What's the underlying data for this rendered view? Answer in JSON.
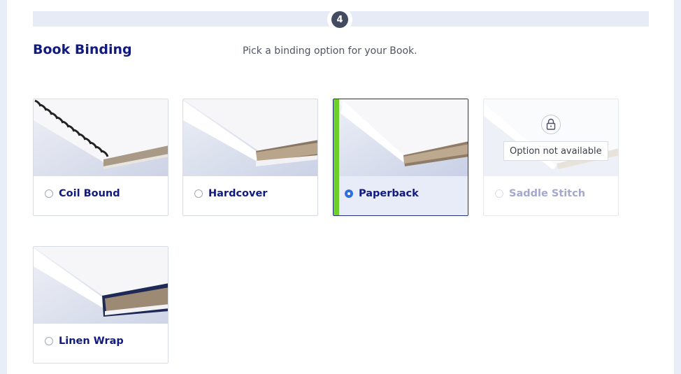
{
  "step": {
    "number": "4"
  },
  "section": {
    "title": "Book Binding",
    "description": "Pick a binding option for your Book."
  },
  "bindings": [
    {
      "label": "Coil Bound",
      "selected": false,
      "available": true
    },
    {
      "label": "Hardcover",
      "selected": false,
      "available": true
    },
    {
      "label": "Paperback",
      "selected": true,
      "available": true
    },
    {
      "label": "Saddle Stitch",
      "selected": false,
      "available": false,
      "tooltip": "Option not available"
    },
    {
      "label": "Linen Wrap",
      "selected": false,
      "available": true
    }
  ],
  "colors": {
    "accent": "#6fcf2a",
    "title": "#111a7e",
    "radio_selected": "#2f6fe0"
  }
}
